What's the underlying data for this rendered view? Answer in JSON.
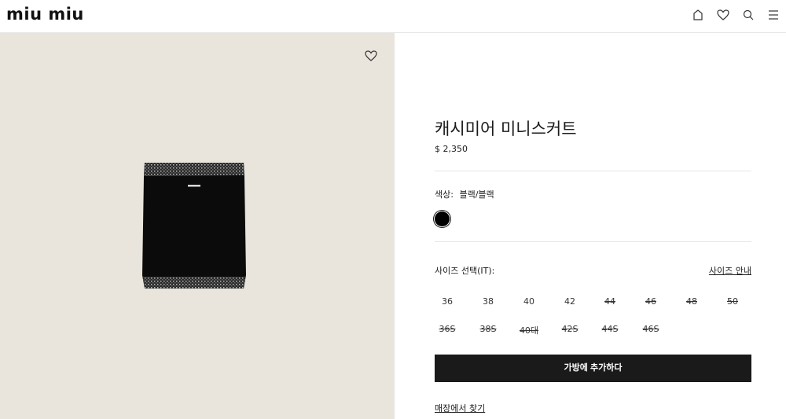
{
  "header": {
    "logo": "miu miu",
    "icons": [
      "bag-icon",
      "heart-icon",
      "search-icon",
      "menu-icon"
    ]
  },
  "product": {
    "title": "캐시미어 미니스커트",
    "price": "$ 2,350",
    "color_label": "색상:",
    "color_value": "블랙/블랙",
    "swatch_color": "#000000",
    "size_label": "사이즈 선택(IT):",
    "size_guide": "사이즈 안내",
    "sizes_row1": [
      {
        "label": "36",
        "available": true
      },
      {
        "label": "38",
        "available": true
      },
      {
        "label": "40",
        "available": true
      },
      {
        "label": "42",
        "available": true
      },
      {
        "label": "44",
        "available": false
      },
      {
        "label": "46",
        "available": false
      },
      {
        "label": "48",
        "available": false
      },
      {
        "label": "50",
        "available": false
      }
    ],
    "sizes_row2": [
      {
        "label": "36S",
        "available": false
      },
      {
        "label": "38S",
        "available": false
      },
      {
        "label": "40대",
        "available": false
      },
      {
        "label": "42S",
        "available": false
      },
      {
        "label": "44S",
        "available": false
      },
      {
        "label": "46S",
        "available": false
      }
    ],
    "add_to_bag": "가방에 추가하다",
    "find_in_store": "매장에서 찾기"
  },
  "colors": {
    "image_bg": "#e9e5dc",
    "button_bg": "#1a1a1a",
    "divider": "#e6e6e6"
  }
}
